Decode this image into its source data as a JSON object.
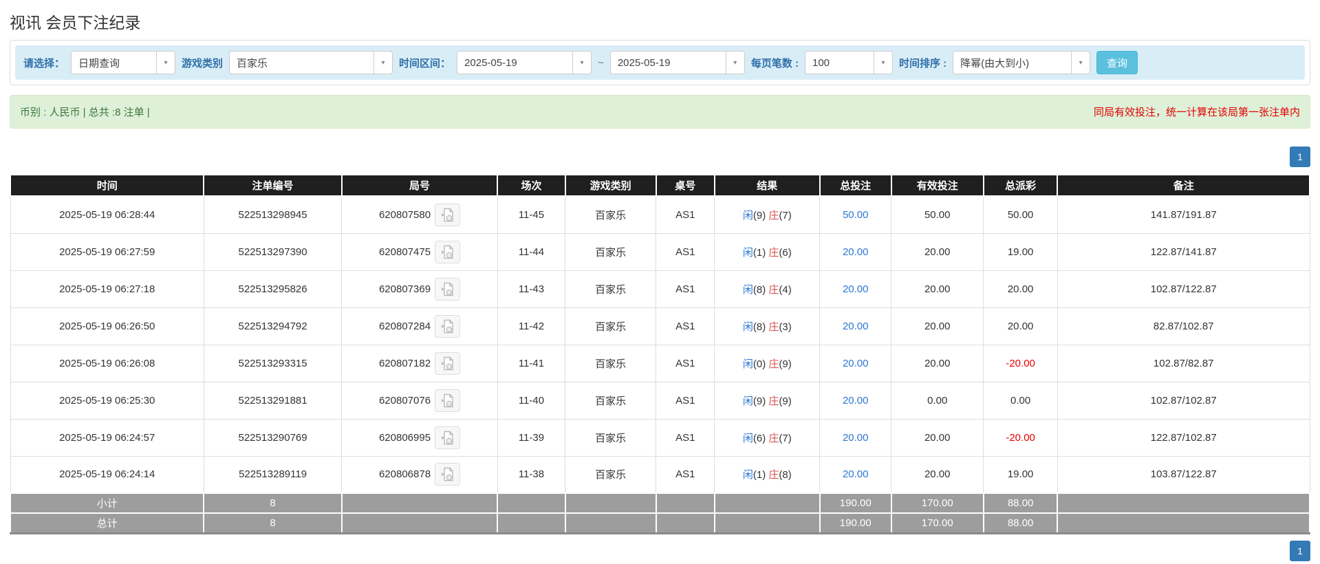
{
  "page": {
    "title": "视讯 会员下注纪录"
  },
  "filters": {
    "select_label": "请选择：",
    "select_value": "日期查询",
    "game_type_label": "游戏类别",
    "game_type_value": "百家乐",
    "time_range_label": "时间区间：",
    "date_from": "2025-05-19",
    "date_separator": "~",
    "date_to": "2025-05-19",
    "page_size_label": "每页笔数 :",
    "page_size_value": "100",
    "sort_label": "时间排序 :",
    "sort_value": "降幂(由大到小)",
    "search_button": "查询"
  },
  "summary": {
    "left_text": "币别 : 人民币 | 总共 :8 注单 |",
    "right_note": "同局有效投注，统一计算在该局第一张注单内"
  },
  "pagination": {
    "current_page": "1"
  },
  "table": {
    "headers": [
      "时间",
      "注单编号",
      "局号",
      "场次",
      "游戏类别",
      "桌号",
      "结果",
      "总投注",
      "有效投注",
      "总派彩",
      "备注"
    ],
    "col_widths_pct": [
      14.9,
      10.6,
      12.0,
      5.2,
      7.0,
      4.5,
      8.1,
      5.5,
      7.1,
      5.7,
      19.4
    ],
    "result_labels": {
      "player": "闲",
      "banker": "庄"
    },
    "rows": [
      {
        "time": "2025-05-19 06:28:44",
        "bet_id": "522513298945",
        "round_id": "620807580",
        "session": "11-45",
        "game": "百家乐",
        "table_no": "AS1",
        "player": "(9)",
        "banker": "(7)",
        "total_bet": "50.00",
        "valid_bet": "50.00",
        "payout": "50.00",
        "remark": "141.87/191.87"
      },
      {
        "time": "2025-05-19 06:27:59",
        "bet_id": "522513297390",
        "round_id": "620807475",
        "session": "11-44",
        "game": "百家乐",
        "table_no": "AS1",
        "player": "(1)",
        "banker": "(6)",
        "total_bet": "20.00",
        "valid_bet": "20.00",
        "payout": "19.00",
        "remark": "122.87/141.87"
      },
      {
        "time": "2025-05-19 06:27:18",
        "bet_id": "522513295826",
        "round_id": "620807369",
        "session": "11-43",
        "game": "百家乐",
        "table_no": "AS1",
        "player": "(8)",
        "banker": "(4)",
        "total_bet": "20.00",
        "valid_bet": "20.00",
        "payout": "20.00",
        "remark": "102.87/122.87"
      },
      {
        "time": "2025-05-19 06:26:50",
        "bet_id": "522513294792",
        "round_id": "620807284",
        "session": "11-42",
        "game": "百家乐",
        "table_no": "AS1",
        "player": "(8)",
        "banker": "(3)",
        "total_bet": "20.00",
        "valid_bet": "20.00",
        "payout": "20.00",
        "remark": "82.87/102.87"
      },
      {
        "time": "2025-05-19 06:26:08",
        "bet_id": "522513293315",
        "round_id": "620807182",
        "session": "11-41",
        "game": "百家乐",
        "table_no": "AS1",
        "player": "(0)",
        "banker": "(9)",
        "total_bet": "20.00",
        "valid_bet": "20.00",
        "payout": "-20.00",
        "remark": "102.87/82.87"
      },
      {
        "time": "2025-05-19 06:25:30",
        "bet_id": "522513291881",
        "round_id": "620807076",
        "session": "11-40",
        "game": "百家乐",
        "table_no": "AS1",
        "player": "(9)",
        "banker": "(9)",
        "total_bet": "20.00",
        "valid_bet": "0.00",
        "payout": "0.00",
        "remark": "102.87/102.87"
      },
      {
        "time": "2025-05-19 06:24:57",
        "bet_id": "522513290769",
        "round_id": "620806995",
        "session": "11-39",
        "game": "百家乐",
        "table_no": "AS1",
        "player": "(6)",
        "banker": "(7)",
        "total_bet": "20.00",
        "valid_bet": "20.00",
        "payout": "-20.00",
        "remark": "122.87/102.87"
      },
      {
        "time": "2025-05-19 06:24:14",
        "bet_id": "522513289119",
        "round_id": "620806878",
        "session": "11-38",
        "game": "百家乐",
        "table_no": "AS1",
        "player": "(1)",
        "banker": "(8)",
        "total_bet": "20.00",
        "valid_bet": "20.00",
        "payout": "19.00",
        "remark": "103.87/122.87"
      }
    ],
    "footer": [
      {
        "label": "小计",
        "count": "8",
        "total_bet": "190.00",
        "valid_bet": "170.00",
        "payout": "88.00"
      },
      {
        "label": "总计",
        "count": "8",
        "total_bet": "190.00",
        "valid_bet": "170.00",
        "payout": "88.00"
      }
    ]
  },
  "colors": {
    "accent": "#5bc0de",
    "link_blue": "#2a77d4",
    "player_blue": "#2a77d4",
    "banker_red": "#d9534f",
    "negative_red": "#e60000",
    "header_bg": "#1f1f1f",
    "footer_bg": "#9d9d9d",
    "summary_bg": "#dff0d8",
    "summary_text": "#3c763d",
    "note_red": "#e10000",
    "filter_bg": "#d9edf7",
    "label_blue": "#3071a9",
    "pagination_blue": "#337ab7"
  }
}
